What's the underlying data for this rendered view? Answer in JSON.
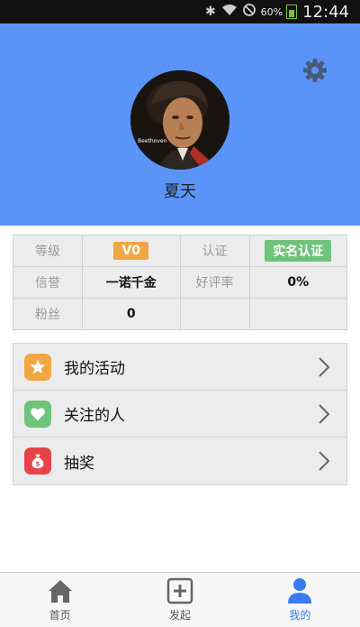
{
  "status_bar": {
    "battery_percent": "60%",
    "time": "12:44",
    "icons": [
      "bluetooth-icon",
      "wifi-icon",
      "mute-icon",
      "battery-icon"
    ]
  },
  "profile": {
    "username": "夏天",
    "avatar_caption": "Beethoven"
  },
  "info_table": {
    "level_label": "等级",
    "level_value": "V0",
    "verify_label": "认证",
    "verify_value": "实名认证",
    "credit_label": "信誉",
    "credit_value": "一诺千金",
    "rating_label": "好评率",
    "rating_value": "0%",
    "fans_label": "粉丝",
    "fans_value": "0"
  },
  "menu": {
    "items": [
      {
        "label": "我的活动",
        "icon": "star-icon",
        "color": "#f0a643"
      },
      {
        "label": "关注的人",
        "icon": "heart-icon",
        "color": "#6fc37a"
      },
      {
        "label": "抽奖",
        "icon": "money-bag-icon",
        "color": "#e8434a"
      }
    ]
  },
  "bottom_nav": {
    "tabs": [
      {
        "label": "首页",
        "icon": "home-icon",
        "active": false
      },
      {
        "label": "发起",
        "icon": "plus-square-icon",
        "active": false
      },
      {
        "label": "我的",
        "icon": "person-icon",
        "active": true
      }
    ]
  },
  "colors": {
    "header": "#5b94f8",
    "accent": "#3a7cf0",
    "level_badge": "#f0a643",
    "verified_badge": "#6fc37a"
  }
}
